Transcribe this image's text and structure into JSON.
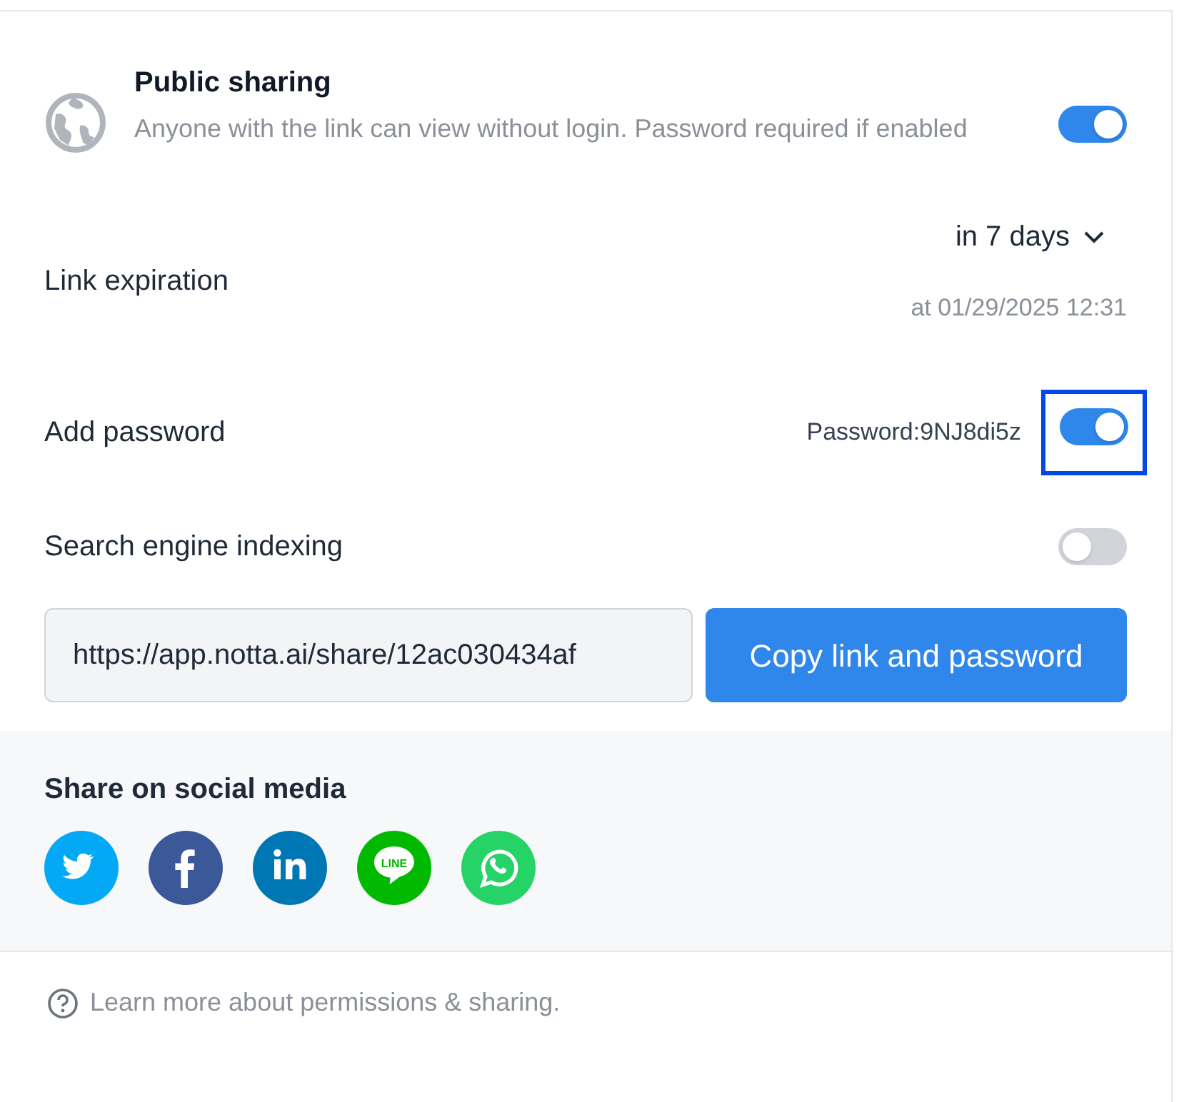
{
  "public_sharing": {
    "title": "Public sharing",
    "description": "Anyone with the link can view without login. Password required if enabled",
    "on": true
  },
  "settings": [
    {
      "kind": "expiration",
      "label": "Link expiration",
      "value": "in 7 days",
      "note": "at 01/29/2025 12:31"
    },
    {
      "kind": "password",
      "label": "Add password",
      "value": "Password:9NJ8di5z",
      "on": true,
      "focused": true
    },
    {
      "kind": "toggle",
      "label": "Search engine indexing",
      "on": false
    }
  ],
  "link": {
    "value": "https://app.notta.ai/share/12ac030434af",
    "button": "Copy link and password"
  },
  "social": {
    "title": "Share on social media",
    "items": [
      {
        "kind": "twitter",
        "color": "#03a9f4"
      },
      {
        "kind": "facebook",
        "color": "#3b5998"
      },
      {
        "kind": "linkedin",
        "color": "#0077b5"
      },
      {
        "kind": "line",
        "color": "#00b900",
        "text": "LINE"
      },
      {
        "kind": "whatsapp",
        "color": "#25d366"
      }
    ]
  },
  "footer": {
    "text": "Learn more about permissions & sharing."
  }
}
